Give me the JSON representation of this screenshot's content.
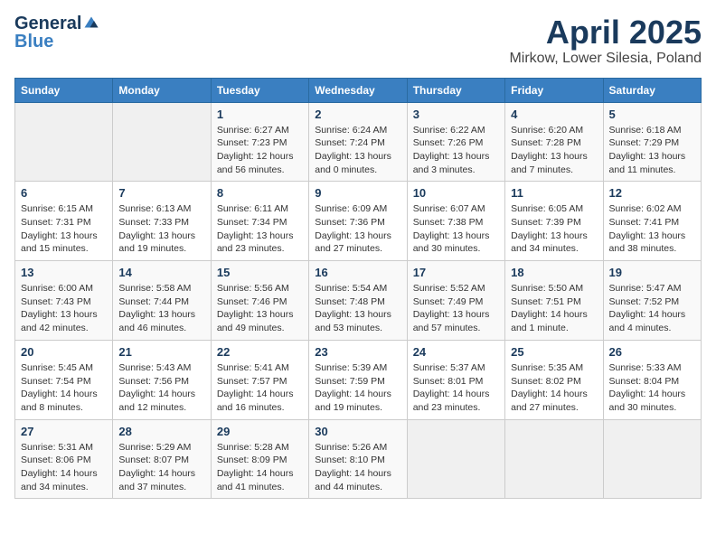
{
  "header": {
    "logo_general": "General",
    "logo_blue": "Blue",
    "title": "April 2025",
    "location": "Mirkow, Lower Silesia, Poland"
  },
  "weekdays": [
    "Sunday",
    "Monday",
    "Tuesday",
    "Wednesday",
    "Thursday",
    "Friday",
    "Saturday"
  ],
  "weeks": [
    [
      {
        "day": "",
        "info": ""
      },
      {
        "day": "",
        "info": ""
      },
      {
        "day": "1",
        "info": "Sunrise: 6:27 AM\nSunset: 7:23 PM\nDaylight: 12 hours and 56 minutes."
      },
      {
        "day": "2",
        "info": "Sunrise: 6:24 AM\nSunset: 7:24 PM\nDaylight: 13 hours and 0 minutes."
      },
      {
        "day": "3",
        "info": "Sunrise: 6:22 AM\nSunset: 7:26 PM\nDaylight: 13 hours and 3 minutes."
      },
      {
        "day": "4",
        "info": "Sunrise: 6:20 AM\nSunset: 7:28 PM\nDaylight: 13 hours and 7 minutes."
      },
      {
        "day": "5",
        "info": "Sunrise: 6:18 AM\nSunset: 7:29 PM\nDaylight: 13 hours and 11 minutes."
      }
    ],
    [
      {
        "day": "6",
        "info": "Sunrise: 6:15 AM\nSunset: 7:31 PM\nDaylight: 13 hours and 15 minutes."
      },
      {
        "day": "7",
        "info": "Sunrise: 6:13 AM\nSunset: 7:33 PM\nDaylight: 13 hours and 19 minutes."
      },
      {
        "day": "8",
        "info": "Sunrise: 6:11 AM\nSunset: 7:34 PM\nDaylight: 13 hours and 23 minutes."
      },
      {
        "day": "9",
        "info": "Sunrise: 6:09 AM\nSunset: 7:36 PM\nDaylight: 13 hours and 27 minutes."
      },
      {
        "day": "10",
        "info": "Sunrise: 6:07 AM\nSunset: 7:38 PM\nDaylight: 13 hours and 30 minutes."
      },
      {
        "day": "11",
        "info": "Sunrise: 6:05 AM\nSunset: 7:39 PM\nDaylight: 13 hours and 34 minutes."
      },
      {
        "day": "12",
        "info": "Sunrise: 6:02 AM\nSunset: 7:41 PM\nDaylight: 13 hours and 38 minutes."
      }
    ],
    [
      {
        "day": "13",
        "info": "Sunrise: 6:00 AM\nSunset: 7:43 PM\nDaylight: 13 hours and 42 minutes."
      },
      {
        "day": "14",
        "info": "Sunrise: 5:58 AM\nSunset: 7:44 PM\nDaylight: 13 hours and 46 minutes."
      },
      {
        "day": "15",
        "info": "Sunrise: 5:56 AM\nSunset: 7:46 PM\nDaylight: 13 hours and 49 minutes."
      },
      {
        "day": "16",
        "info": "Sunrise: 5:54 AM\nSunset: 7:48 PM\nDaylight: 13 hours and 53 minutes."
      },
      {
        "day": "17",
        "info": "Sunrise: 5:52 AM\nSunset: 7:49 PM\nDaylight: 13 hours and 57 minutes."
      },
      {
        "day": "18",
        "info": "Sunrise: 5:50 AM\nSunset: 7:51 PM\nDaylight: 14 hours and 1 minute."
      },
      {
        "day": "19",
        "info": "Sunrise: 5:47 AM\nSunset: 7:52 PM\nDaylight: 14 hours and 4 minutes."
      }
    ],
    [
      {
        "day": "20",
        "info": "Sunrise: 5:45 AM\nSunset: 7:54 PM\nDaylight: 14 hours and 8 minutes."
      },
      {
        "day": "21",
        "info": "Sunrise: 5:43 AM\nSunset: 7:56 PM\nDaylight: 14 hours and 12 minutes."
      },
      {
        "day": "22",
        "info": "Sunrise: 5:41 AM\nSunset: 7:57 PM\nDaylight: 14 hours and 16 minutes."
      },
      {
        "day": "23",
        "info": "Sunrise: 5:39 AM\nSunset: 7:59 PM\nDaylight: 14 hours and 19 minutes."
      },
      {
        "day": "24",
        "info": "Sunrise: 5:37 AM\nSunset: 8:01 PM\nDaylight: 14 hours and 23 minutes."
      },
      {
        "day": "25",
        "info": "Sunrise: 5:35 AM\nSunset: 8:02 PM\nDaylight: 14 hours and 27 minutes."
      },
      {
        "day": "26",
        "info": "Sunrise: 5:33 AM\nSunset: 8:04 PM\nDaylight: 14 hours and 30 minutes."
      }
    ],
    [
      {
        "day": "27",
        "info": "Sunrise: 5:31 AM\nSunset: 8:06 PM\nDaylight: 14 hours and 34 minutes."
      },
      {
        "day": "28",
        "info": "Sunrise: 5:29 AM\nSunset: 8:07 PM\nDaylight: 14 hours and 37 minutes."
      },
      {
        "day": "29",
        "info": "Sunrise: 5:28 AM\nSunset: 8:09 PM\nDaylight: 14 hours and 41 minutes."
      },
      {
        "day": "30",
        "info": "Sunrise: 5:26 AM\nSunset: 8:10 PM\nDaylight: 14 hours and 44 minutes."
      },
      {
        "day": "",
        "info": ""
      },
      {
        "day": "",
        "info": ""
      },
      {
        "day": "",
        "info": ""
      }
    ]
  ]
}
